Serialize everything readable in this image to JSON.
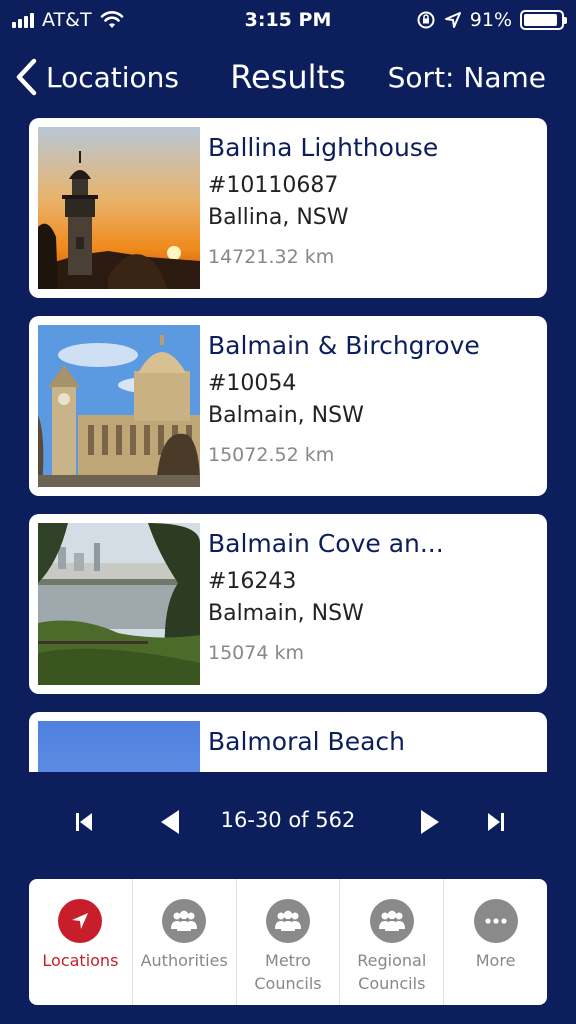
{
  "status_bar": {
    "carrier": "AT&T",
    "time": "3:15 PM",
    "battery": "91%",
    "battery_level": 0.91,
    "icons": [
      "signal-icon",
      "wifi-icon",
      "orientation-lock-icon",
      "location-arrow-icon",
      "battery-icon"
    ]
  },
  "nav": {
    "back_label": "Locations",
    "title": "Results",
    "sort_label": "Sort: Name"
  },
  "results": [
    {
      "name": "Ballina Lighthouse",
      "code": "#10110687",
      "location": "Ballina, NSW",
      "distance": "14721.32 km",
      "image": "lighthouse-sunset"
    },
    {
      "name": "Balmain & Birchgrove",
      "code": "#10054",
      "location": "Balmain, NSW",
      "distance": "15072.52 km",
      "image": "historic-building"
    },
    {
      "name": "Balmain Cove an...",
      "code": "#16243",
      "location": "Balmain, NSW",
      "distance": "15074 km",
      "image": "cove-waterfront"
    },
    {
      "name": "Balmoral Beach",
      "code": "",
      "location": "",
      "distance": "",
      "image": "blue-sky"
    }
  ],
  "pagination": {
    "text": "16-30 of 562"
  },
  "tabs": [
    {
      "label": "Locations",
      "icon": "location-arrow-icon",
      "active": true
    },
    {
      "label": "Authorities",
      "icon": "group-icon",
      "active": false
    },
    {
      "label": "Metro\nCouncils",
      "icon": "group-icon",
      "active": false
    },
    {
      "label": "Regional\nCouncils",
      "icon": "group-icon",
      "active": false
    },
    {
      "label": "More",
      "icon": "more-icon",
      "active": false
    }
  ],
  "colors": {
    "background": "#0c1f5c",
    "active_tab": "#c81e2c",
    "inactive_icon": "#8a8a8a"
  }
}
